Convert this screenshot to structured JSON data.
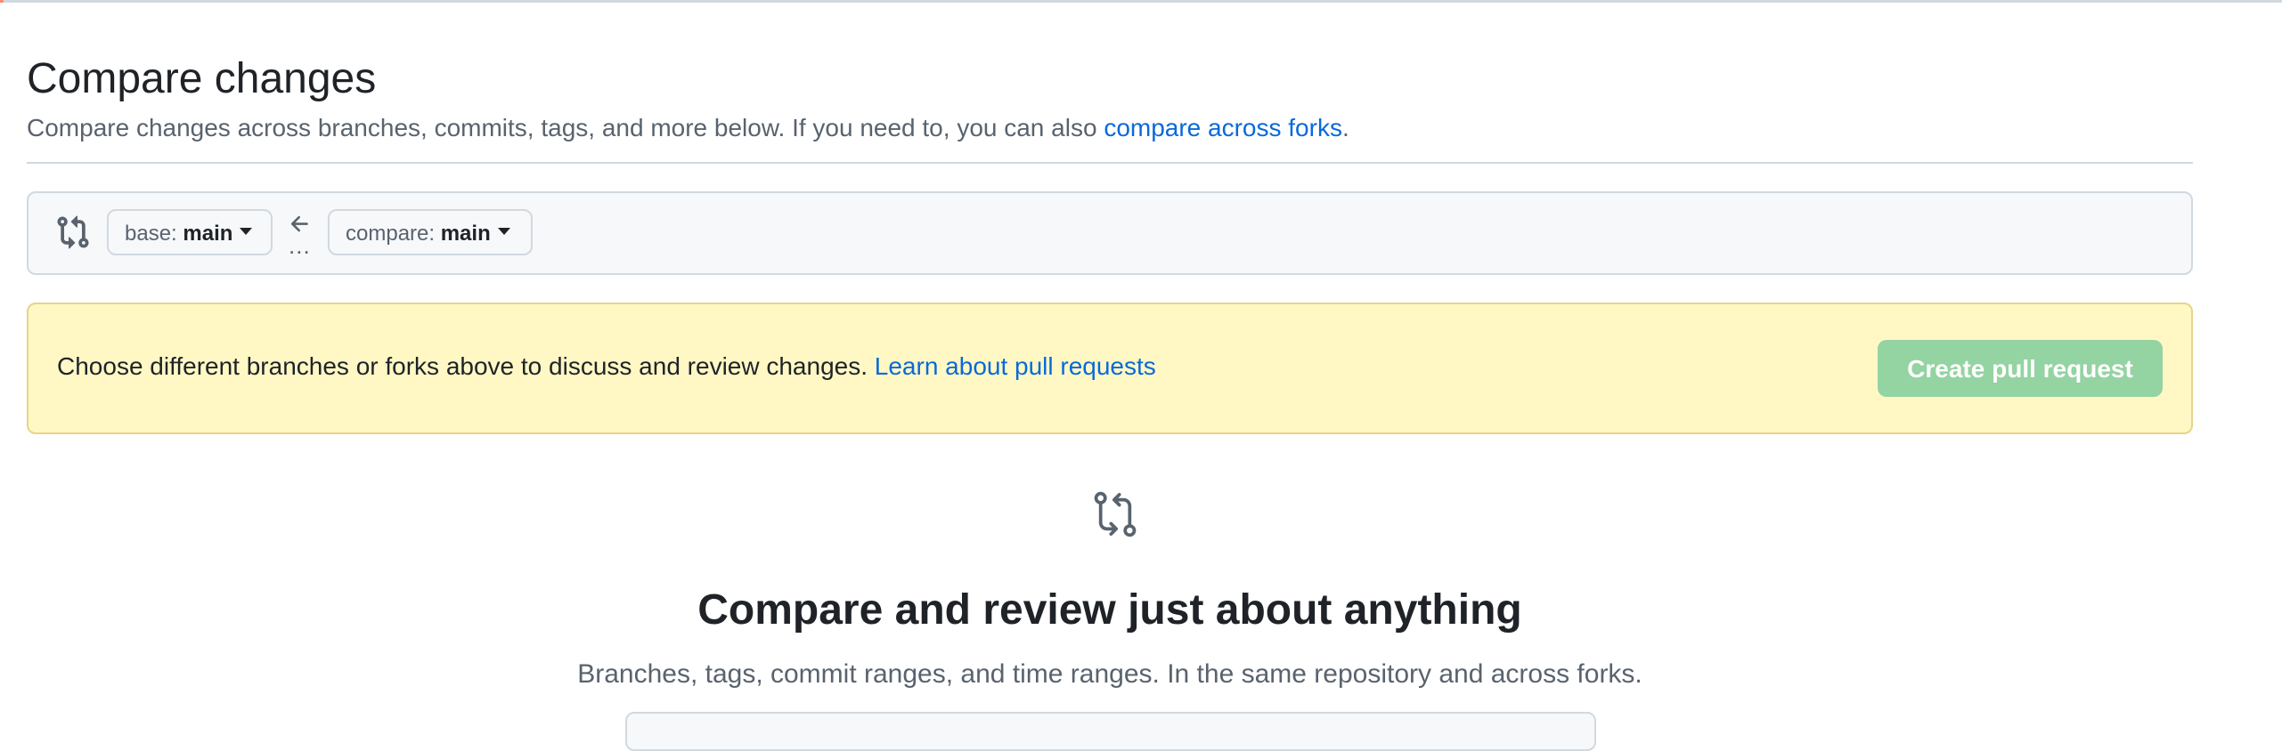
{
  "header": {
    "title": "Compare changes",
    "subtitle_text": "Compare changes across branches, commits, tags, and more below. If you need to, you can also ",
    "subtitle_link": "compare across forks",
    "subtitle_end": "."
  },
  "range_editor": {
    "base_prefix": "base: ",
    "base_branch": "main",
    "compare_prefix": "compare: ",
    "compare_branch": "main",
    "dots": "..."
  },
  "flash": {
    "message": "Choose different branches or forks above to discuss and review changes. ",
    "link": "Learn about pull requests",
    "create_button": "Create pull request"
  },
  "blankslate": {
    "title": "Compare and review just about anything",
    "description": "Branches, tags, commit ranges, and time ranges. In the same repository and across forks."
  },
  "colors": {
    "link": "#0969da",
    "create_button_disabled": "#94d3a2",
    "flash_background": "#fff8c5",
    "box_background": "#f6f8fa"
  },
  "icons": {
    "range_icon": "git-compare-icon",
    "arrow": "arrow-left-icon",
    "blankslate_icon": "git-compare-icon"
  }
}
